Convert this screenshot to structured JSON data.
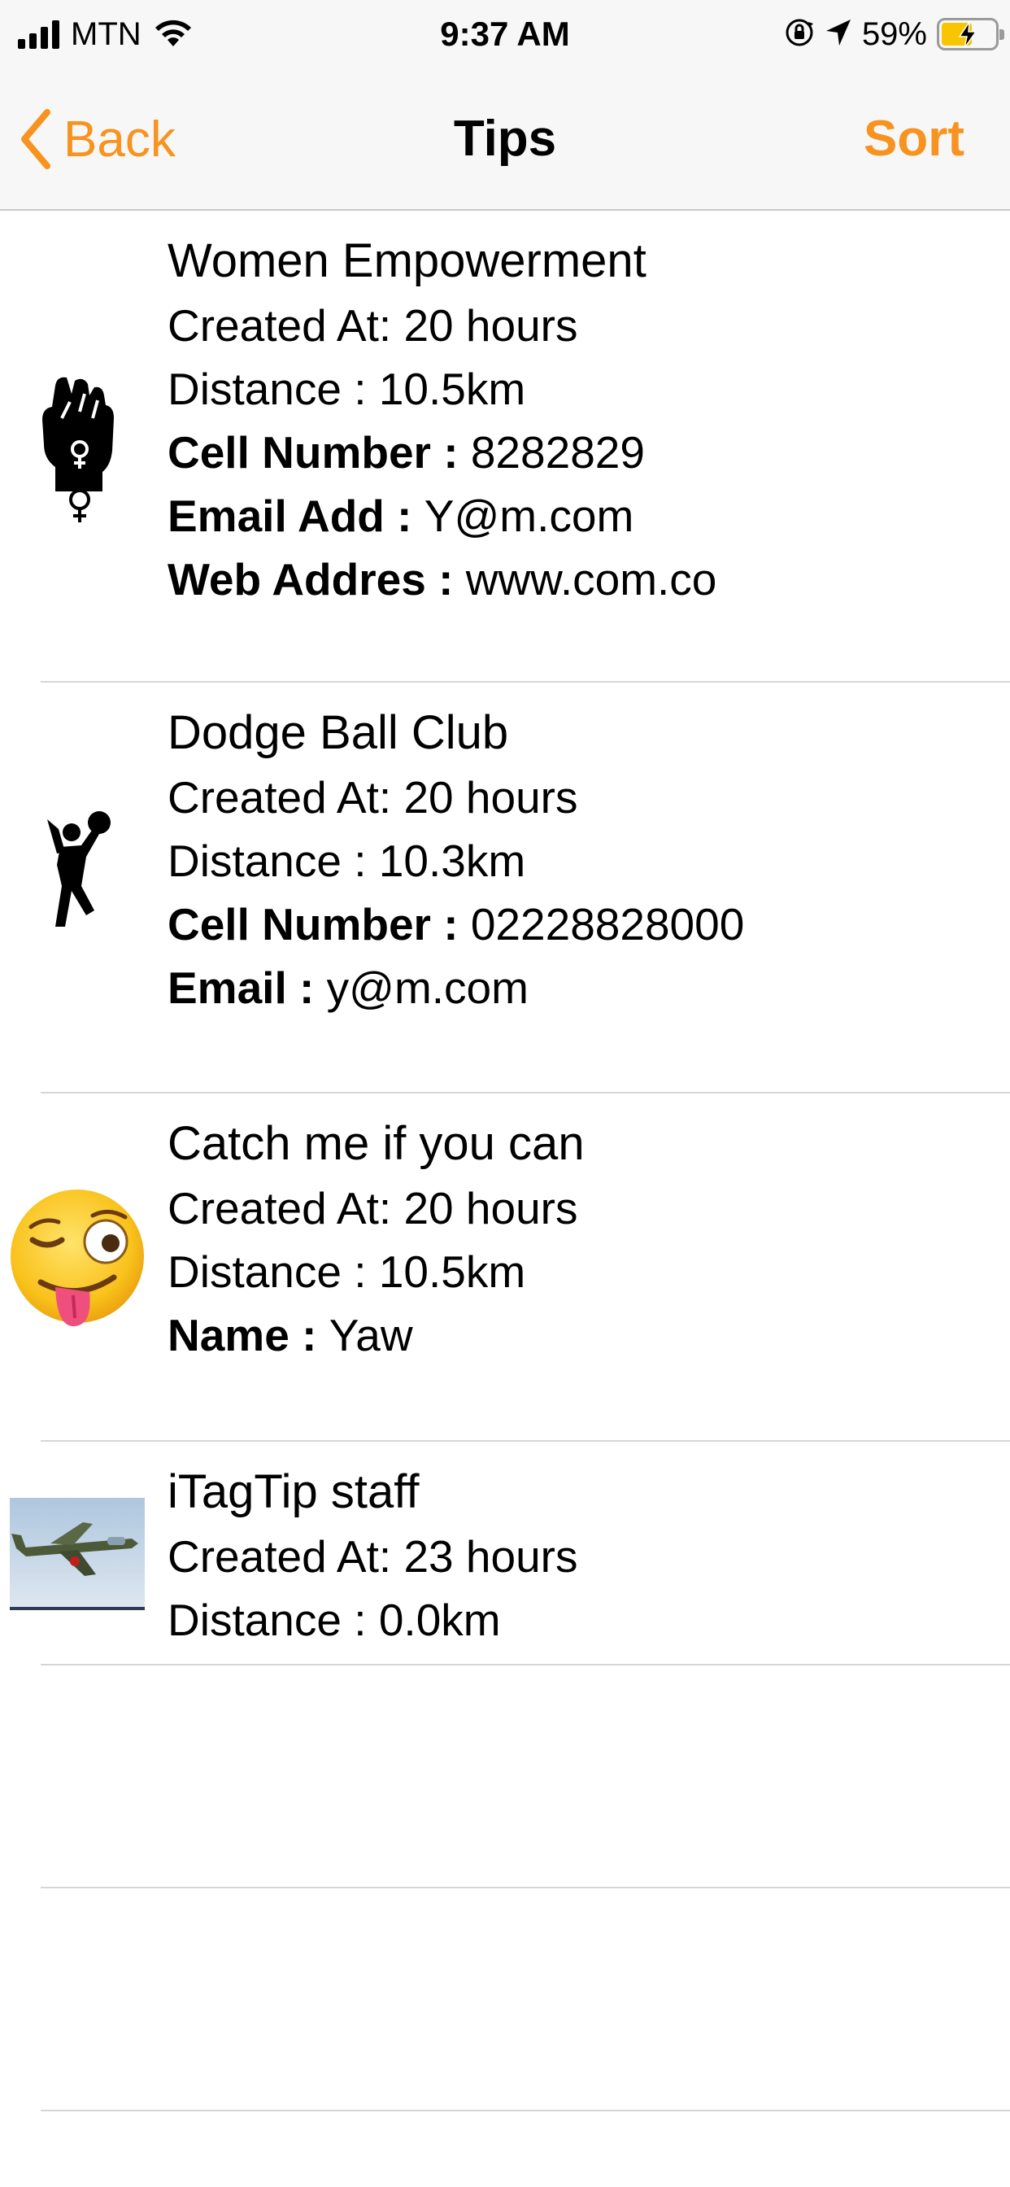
{
  "status_bar": {
    "carrier": "MTN",
    "time": "9:37 AM",
    "battery_percent": "59%",
    "battery_level": 0.59,
    "icons": [
      "signal-icon",
      "wifi-icon",
      "orientation-lock-icon",
      "location-icon",
      "battery-charging-icon"
    ]
  },
  "nav": {
    "back_label": "Back",
    "title": "Tips",
    "sort_label": "Sort",
    "accent_color": "#f7931e"
  },
  "tips": [
    {
      "thumbnail": "raised-fist-female-symbol-icon",
      "title": "Women Empowerment",
      "lines": [
        {
          "label": "Created At: ",
          "value": "20 hours",
          "bold": false
        },
        {
          "label": "Distance : ",
          "value": "10.5km",
          "bold": false
        },
        {
          "label": "Cell Number : ",
          "value": "8282829",
          "bold": true
        },
        {
          "label": "Email Add : ",
          "value": "Y@m.com",
          "bold": true
        },
        {
          "label": "Web Addres : ",
          "value": "www.com.co",
          "bold": true
        }
      ]
    },
    {
      "thumbnail": "dodgeball-player-icon",
      "title": "Dodge Ball Club",
      "lines": [
        {
          "label": "Created At: ",
          "value": "20 hours",
          "bold": false
        },
        {
          "label": "Distance : ",
          "value": "10.3km",
          "bold": false
        },
        {
          "label": "Cell Number : ",
          "value": "02228828000",
          "bold": true
        },
        {
          "label": "Email : ",
          "value": "y@m.com",
          "bold": true
        }
      ]
    },
    {
      "thumbnail": "winking-tongue-emoji-icon",
      "title": "Catch me if you can",
      "lines": [
        {
          "label": "Created At: ",
          "value": "20 hours",
          "bold": false
        },
        {
          "label": "Distance : ",
          "value": "10.5km",
          "bold": false
        },
        {
          "label": "Name : ",
          "value": "Yaw",
          "bold": true
        }
      ]
    },
    {
      "thumbnail": "airplane-photo",
      "title": "iTagTip staff",
      "lines": [
        {
          "label": "Created At: ",
          "value": "23 hours",
          "bold": false
        },
        {
          "label": "Distance : ",
          "value": "0.0km",
          "bold": false
        }
      ]
    }
  ]
}
